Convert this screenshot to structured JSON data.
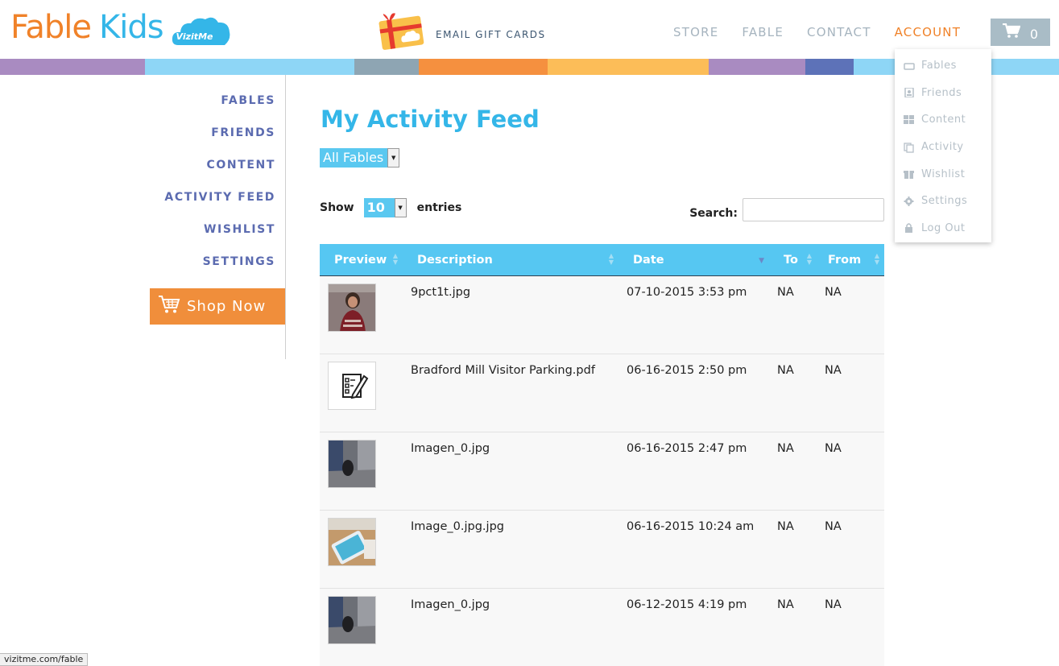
{
  "header": {
    "logo_fable": "Fable",
    "logo_kids": "Kids",
    "logo_badge": "VizitMe",
    "gift_cards": "EMAIL GIFT CARDS",
    "nav": [
      "STORE",
      "FABLE",
      "CONTACT",
      "ACCOUNT"
    ],
    "active_nav": "ACCOUNT",
    "cart_count": "0"
  },
  "colors": {
    "orange": "#f08229",
    "blue": "#34b6e8",
    "nav_grey": "#a6b4bf",
    "sidebar_purple": "#5b6bb0",
    "table_header": "#56c7f2"
  },
  "account_menu": [
    {
      "label": "Fables",
      "icon": "tablet-icon"
    },
    {
      "label": "Friends",
      "icon": "contact-card-icon"
    },
    {
      "label": "Content",
      "icon": "grid-icon"
    },
    {
      "label": "Activity",
      "icon": "copy-icon"
    },
    {
      "label": "Wishlist",
      "icon": "gift-icon"
    },
    {
      "label": "Settings",
      "icon": "gear-icon"
    },
    {
      "label": "Log Out",
      "icon": "lock-icon"
    }
  ],
  "sidebar": {
    "items": [
      "FABLES",
      "FRIENDS",
      "CONTENT",
      "ACTIVITY FEED",
      "WISHLIST",
      "SETTINGS"
    ],
    "shop_now": "Shop Now"
  },
  "main": {
    "title": "My Activity Feed",
    "fable_filter": "All Fables",
    "show_label": "Show",
    "entries_value": "10",
    "entries_label": "entries",
    "search_label": "Search:",
    "search_value": ""
  },
  "table": {
    "columns": [
      "Preview",
      "Description",
      "Date",
      "To",
      "From"
    ],
    "sorted_column": "Date",
    "rows": [
      {
        "thumb": "photo-person",
        "description": "9pct1t.jpg",
        "date": "07-10-2015 3:53 pm",
        "to": "NA",
        "from": "NA"
      },
      {
        "thumb": "document-icon",
        "description": "Bradford Mill Visitor Parking.pdf",
        "date": "06-16-2015 2:50 pm",
        "to": "NA",
        "from": "NA"
      },
      {
        "thumb": "photo-room",
        "description": "Imagen_0.jpg",
        "date": "06-16-2015 2:47 pm",
        "to": "NA",
        "from": "NA"
      },
      {
        "thumb": "photo-tablet",
        "description": "Image_0.jpg.jpg",
        "date": "06-16-2015 10:24 am",
        "to": "NA",
        "from": "NA"
      },
      {
        "thumb": "photo-room",
        "description": "Imagen_0.jpg",
        "date": "06-12-2015 4:19 pm",
        "to": "NA",
        "from": "NA"
      }
    ]
  },
  "status_bar": "vizitme.com/fable"
}
